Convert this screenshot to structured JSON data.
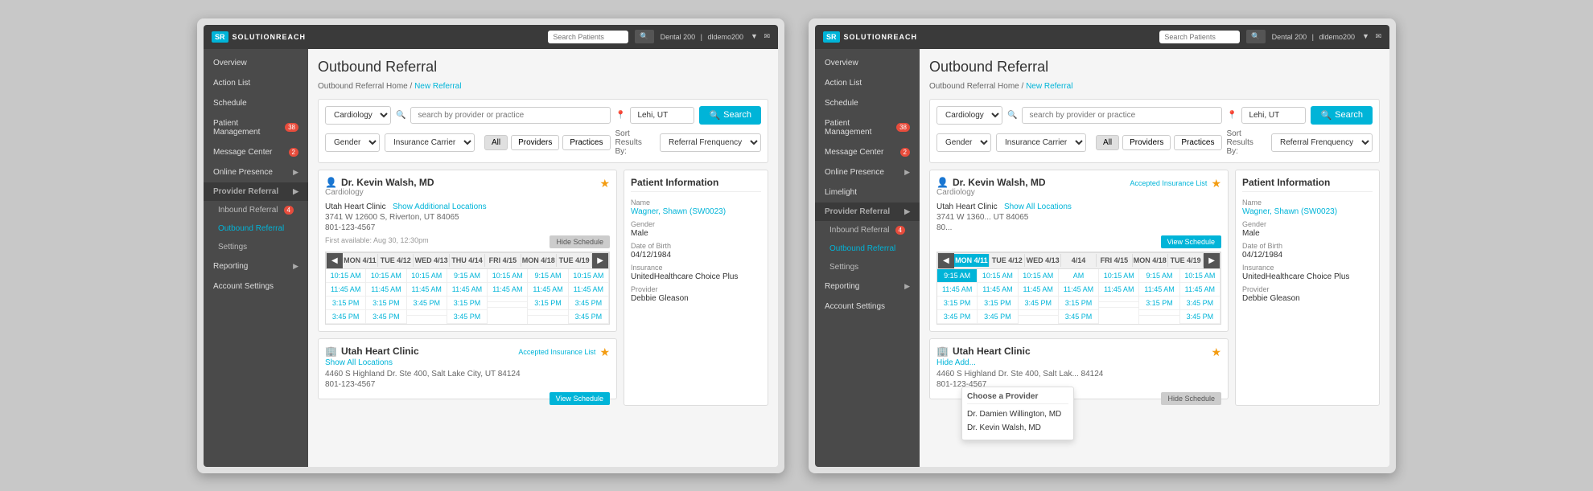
{
  "app": {
    "logo": "SR",
    "logo_full": "SOLUTIONREACH",
    "search_placeholder": "Search Patients",
    "top_bar_info": "Dental 200",
    "top_bar_user": "dldemo200"
  },
  "sidebar": {
    "items": [
      {
        "label": "Overview",
        "badge": null
      },
      {
        "label": "Action List",
        "badge": null
      },
      {
        "label": "Schedule",
        "badge": null
      },
      {
        "label": "Patient Management",
        "badge": "38"
      },
      {
        "label": "Message Center",
        "badge": "2"
      },
      {
        "label": "Online Presence",
        "badge": null
      },
      {
        "label": "Limelight",
        "badge": null
      }
    ],
    "provider_referral": "Provider Referral",
    "sub_items": [
      {
        "label": "Inbound Referral",
        "badge": "4"
      },
      {
        "label": "Outbound Referral",
        "active": true
      },
      {
        "label": "Settings"
      }
    ],
    "bottom_items": [
      {
        "label": "Reporting"
      },
      {
        "label": "Account Settings"
      }
    ]
  },
  "page": {
    "title": "Outbound Referral",
    "breadcrumb_home": "Outbound Referral Home",
    "breadcrumb_separator": " / ",
    "breadcrumb_current": "New Referral"
  },
  "search": {
    "specialty_value": "Cardiology",
    "provider_placeholder": "search by provider or practice",
    "location_value": "Lehi, UT",
    "filter_gender": "Gender",
    "filter_insurance": "Insurance Carrier",
    "button_label": "Search",
    "tab_all": "All",
    "tab_providers": "Providers",
    "tab_practices": "Practices",
    "sort_label": "Sort Results By:",
    "sort_value": "Referral Frenquency"
  },
  "screen1": {
    "provider": {
      "name": "Dr. Kevin Walsh, MD",
      "specialty": "Cardiology",
      "clinic": "Utah Heart Clinic",
      "show_locations": "Show Additional Locations",
      "address": "3741 W 12600 S, Riverton, UT 84065",
      "phone": "801-123-4567",
      "availability": "First available: Aug 30, 12:30pm",
      "hide_btn": "Hide Schedule",
      "calendar": {
        "days": [
          "MON 4/11",
          "TUE 4/12",
          "WED 4/13",
          "THU 4/14",
          "FRI 4/15",
          "MON 4/18",
          "TUE 4/19"
        ],
        "slots": [
          [
            "10:15 AM",
            "10:15 AM",
            "10:15 AM",
            "9:15 AM",
            "10:15 AM",
            "9:15 AM",
            "10:15 AM"
          ],
          [
            "11:45 AM",
            "11:45 AM",
            "11:45 AM",
            "11:45 AM",
            "11:45 AM",
            "11:45 AM",
            "11:45 AM"
          ],
          [
            "3:15 PM",
            "3:15 PM",
            "3:45 PM",
            "3:15 PM",
            "",
            "3:15 PM",
            "3:45 PM"
          ],
          [
            "3:45 PM",
            "3:45 PM",
            "",
            "3:45 PM",
            "",
            "",
            "3:45 PM"
          ]
        ]
      }
    },
    "clinic2": {
      "name": "Utah Heart Clinic",
      "show_locations": "Show All Locations",
      "accepted_ins": "Accepted Insurance List",
      "address": "4460 S Highland Dr. Ste 400, Salt Lake City, UT 84124",
      "phone": "801-123-4567",
      "view_btn": "View Schedule"
    }
  },
  "screen2": {
    "provider": {
      "name": "Dr. Kevin Walsh, MD",
      "specialty": "Cardiology",
      "clinic": "Utah Heart Clinic",
      "show_locations": "Show All Locations",
      "accepted_ins_link": "Accepted Insurance List",
      "address": "3741 W 1360... UT 84065",
      "phone": "80...",
      "view_btn": "View Schedule",
      "calendar": {
        "highlight_day": "MON 4/11",
        "highlight_slot": "9:15 AM",
        "days": [
          "MON 4/11",
          "TUE 4/12",
          "WED 4/13",
          "4/14",
          "FRI 4/15",
          "MON 4/18",
          "TUE 4/19"
        ],
        "slots": [
          [
            "9:15 AM",
            "10:15 AM",
            "10:15 AM",
            "AM",
            "10:15 AM",
            "9:15 AM",
            "10:15 AM"
          ],
          [
            "11:45 AM",
            "11:45 AM",
            "11:45 AM",
            "11:45 AM",
            "11:45 AM",
            "11:45 AM",
            "11:45 AM"
          ],
          [
            "3:15 PM",
            "3:15 PM",
            "3:45 PM",
            "3:15 PM",
            "",
            "3:15 PM",
            "3:45 PM"
          ],
          [
            "3:45 PM",
            "3:45 PM",
            "",
            "3:45 PM",
            "",
            "",
            "3:45 PM"
          ]
        ]
      }
    },
    "clinic2": {
      "name": "Utah Heart Clinic",
      "hide_additional": "Hide Add...",
      "address": "4460 S Highland Dr. Ste 400, Salt Lak... 84124",
      "phone": "801-123-4567",
      "hide_btn": "Hide Schedule"
    },
    "dropdown": {
      "title": "Choose a Provider",
      "items": [
        "Dr. Damien Willington, MD",
        "Dr. Kevin Walsh, MD"
      ]
    }
  },
  "patient": {
    "panel_title": "Patient Information",
    "name_label": "Name",
    "name_value": "Wagner, Shawn (SW0023)",
    "gender_label": "Gender",
    "gender_value": "Male",
    "dob_label": "Date of Birth",
    "dob_value": "04/12/1984",
    "insurance_label": "Insurance",
    "insurance_value": "UnitedHealthcare Choice Plus",
    "provider_label": "Provider",
    "provider_value": "Debbie Gleason"
  }
}
